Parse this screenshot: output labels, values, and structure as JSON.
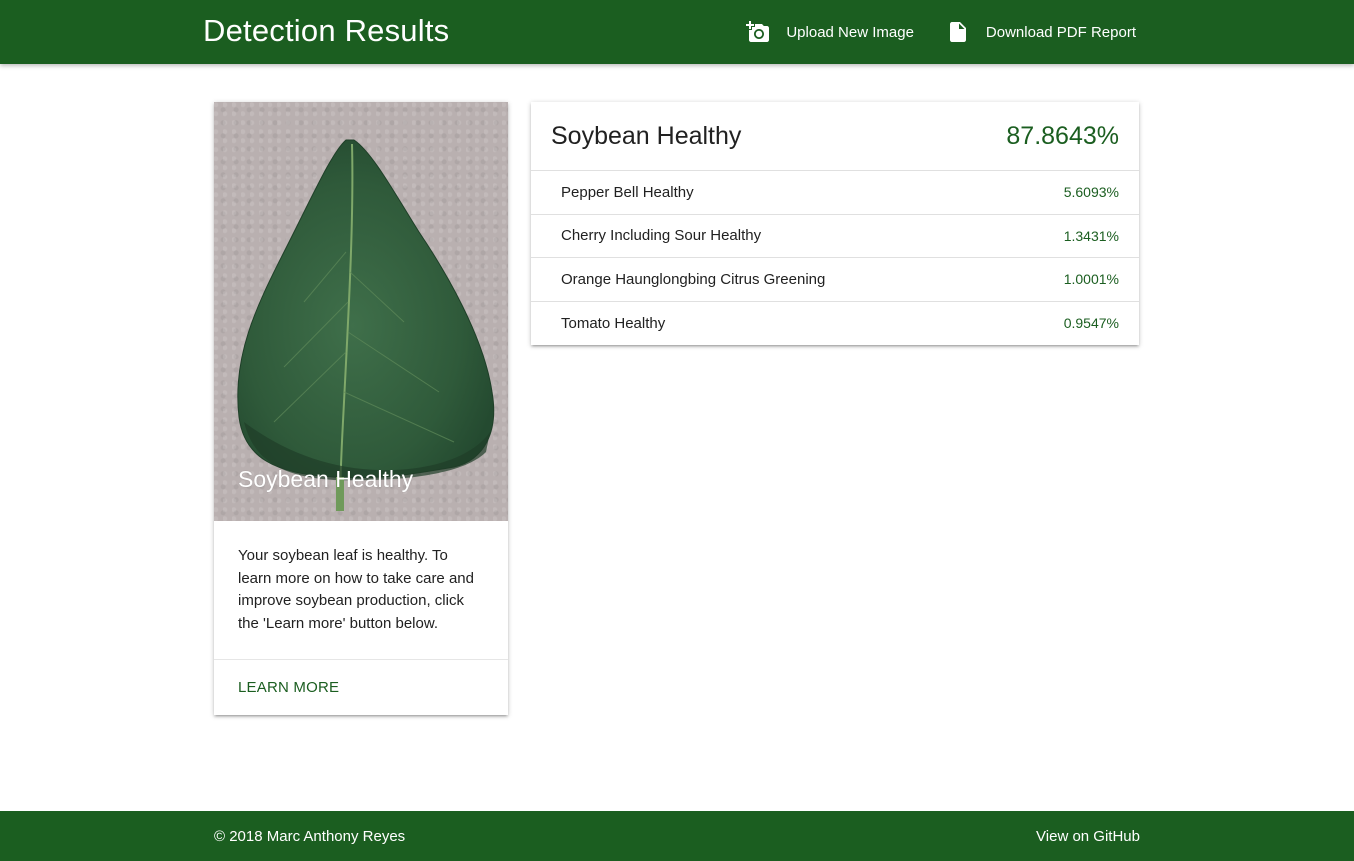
{
  "header": {
    "title": "Detection Results",
    "background_color": "#1b5e20",
    "actions": [
      {
        "label": "Upload New Image",
        "icon": "add-a-photo-icon"
      },
      {
        "label": "Download PDF Report",
        "icon": "document-icon"
      }
    ]
  },
  "image_card": {
    "image_caption": "Soybean Healthy",
    "description": "Your soybean leaf is healthy. To learn more on how to take care and improve soybean production, click the 'Learn more' button below.",
    "action_label": "LEARN MORE"
  },
  "results": {
    "top": {
      "label": "Soybean Healthy",
      "value": "87.8643%"
    },
    "rows": [
      {
        "label": "Pepper Bell Healthy",
        "value": "5.6093%"
      },
      {
        "label": "Cherry Including Sour Healthy",
        "value": "1.3431%"
      },
      {
        "label": "Orange Haunglongbing Citrus Greening",
        "value": "1.0001%"
      },
      {
        "label": "Tomato Healthy",
        "value": "0.9547%"
      }
    ],
    "accent_color": "#1b5e20"
  },
  "footer": {
    "copyright": "© 2018 Marc Anthony Reyes",
    "link_label": "View on GitHub"
  }
}
